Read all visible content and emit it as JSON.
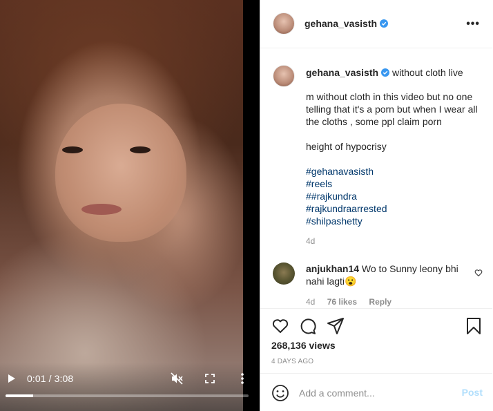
{
  "video": {
    "time_display": "0:01 / 3:08",
    "progress": 0.115,
    "icons": {
      "play": "play-icon",
      "mute": "muted-speaker-icon",
      "fullscreen": "fullscreen-icon",
      "more": "vertical-dots-icon"
    }
  },
  "header": {
    "username": "gehana_vasisth",
    "verified_icon": "verified-badge-icon",
    "more_label": "•••"
  },
  "caption": {
    "username": "gehana_vasisth",
    "title": "without cloth live",
    "paragraph1": "m without cloth in this video but no one telling that it's a porn but when I wear all the cloths , some ppl claim porn",
    "paragraph2": "height of hypocrisy",
    "hashtags": [
      "#gehanavasisth",
      "#reels",
      "##rajkundra",
      "#rajkundraarrested",
      "#shilpashetty"
    ],
    "time": "4d"
  },
  "comment": {
    "username": "anjukhan14",
    "text": "Wo to Sunny leony bhi nahi lagti😮",
    "time": "4d",
    "likes": "76 likes",
    "reply": "Reply"
  },
  "actions": {
    "views": "268,136 views",
    "date": "4 DAYS AGO"
  },
  "add_comment": {
    "placeholder": "Add a comment...",
    "post_label": "Post"
  },
  "colors": {
    "link": "#00376b",
    "verified": "#3897f0",
    "post_disabled": "#b2dffc",
    "muted": "#8e8e8e"
  }
}
